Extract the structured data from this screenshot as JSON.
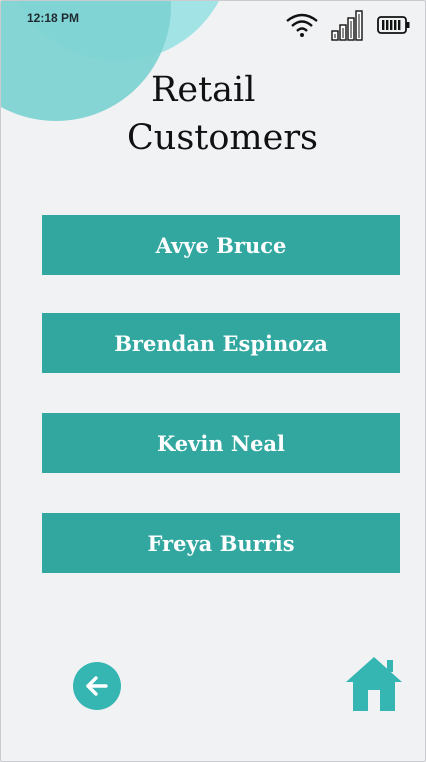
{
  "status_bar": {
    "time": "12:18 PM",
    "icons": [
      "wifi-icon",
      "signal-icon",
      "battery-icon"
    ]
  },
  "title": {
    "line1": "Retail",
    "line2": "Customers"
  },
  "customers": [
    {
      "name": "Avye Bruce"
    },
    {
      "name": "Brendan Espinoza"
    },
    {
      "name": "Kevin Neal"
    },
    {
      "name": "Freya Burris"
    }
  ],
  "nav": {
    "back_icon": "arrow-left-icon",
    "home_icon": "home-icon"
  },
  "colors": {
    "accent": "#31a7a0",
    "background": "#f1f2f4",
    "blob_light": "#94e2e2",
    "blob_dark": "#3fc4c0"
  }
}
